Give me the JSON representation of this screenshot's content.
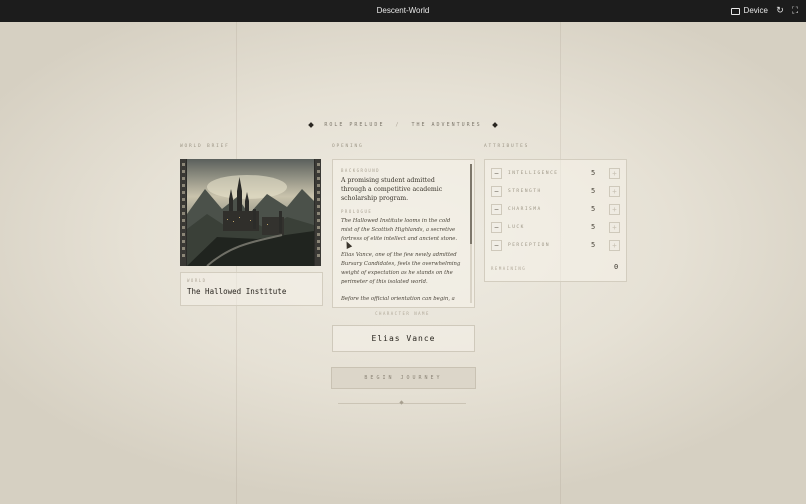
{
  "window": {
    "title": "Descent-World",
    "device_label": "Device"
  },
  "header": {
    "left": "ROLE PRELUDE",
    "separator": "/",
    "right": "THE ADVENTURES"
  },
  "sections": {
    "world": "WORLD BRIEF",
    "opening": "OPENING",
    "attributes": "ATTRIBUTES"
  },
  "world": {
    "caption": "WORLD",
    "name": "The Hallowed Institute"
  },
  "opening": {
    "background_label": "BACKGROUND",
    "background_text": "A promising student admitted through a competitive academic scholarship program.",
    "prologue_label": "PROLOGUE",
    "paragraphs": [
      "The Hallowed Institute looms in the cold mist of the Scottish Highlands, a secretive fortress of elite intellect and ancient stone.",
      "Elias Vance, one of the few newly admitted Bursary Candidates, feels the overwhelming weight of expectation as he stands on the perimeter of this isolated world.",
      "Before the official orientation can begin, a"
    ]
  },
  "character": {
    "caption": "CHARACTER NAME",
    "name": "Elias Vance"
  },
  "actions": {
    "begin": "BEGIN JOURNEY"
  },
  "attributes": {
    "items": [
      {
        "name": "INTELLIGENCE",
        "value": "5",
        "minus": "−",
        "plus": "+"
      },
      {
        "name": "STRENGTH",
        "value": "5",
        "minus": "−",
        "plus": "+"
      },
      {
        "name": "CHARISMA",
        "value": "5",
        "minus": "−",
        "plus": "+"
      },
      {
        "name": "LUCK",
        "value": "5",
        "minus": "−",
        "plus": "+"
      },
      {
        "name": "PERCEPTION",
        "value": "5",
        "minus": "−",
        "plus": "+"
      }
    ],
    "remaining_label": "REMAINING",
    "remaining_value": "0"
  },
  "colors": {
    "background": "#ebe7dc",
    "ink": "#2a2620",
    "topbar": "#1c1c1c"
  }
}
